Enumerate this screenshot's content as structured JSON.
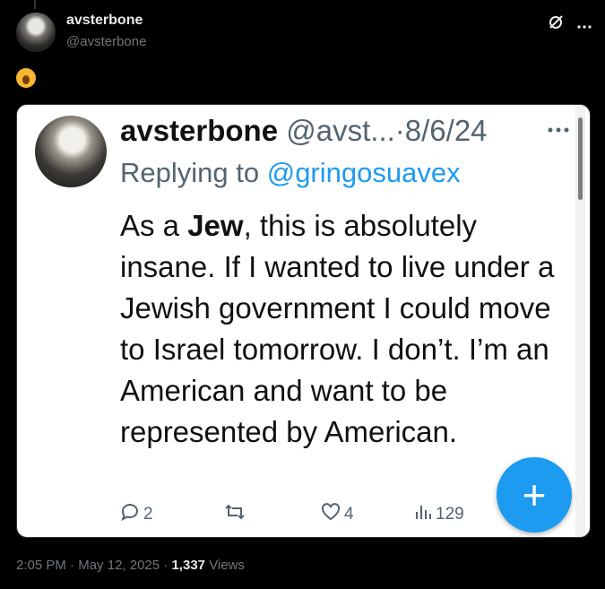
{
  "post": {
    "display_name": "avsterbone",
    "handle": "@avsterbone",
    "timestamp": "2:05 PM",
    "date": "May 12, 2025",
    "views_count": "1,337",
    "views_label": "Views"
  },
  "quoted": {
    "display_name": "avsterbone",
    "handle_truncated": "@avst...",
    "separator": "·",
    "date": "8/6/24",
    "replying_prefix": "Replying to",
    "replying_to": "@gringosuavex",
    "text_pre": "As a ",
    "text_bold": "Jew",
    "text_post": ", this is absolutely insane. If I wanted to live under a Jewish government I could move to Israel tomorrow. I don’t. I’m an American and want to be represented by American.",
    "replies": "2",
    "likes": "4",
    "views": "129"
  },
  "fab_label": "+",
  "colors": {
    "accent": "#1d9bf0",
    "background": "#000000",
    "muted": "#71767b"
  }
}
